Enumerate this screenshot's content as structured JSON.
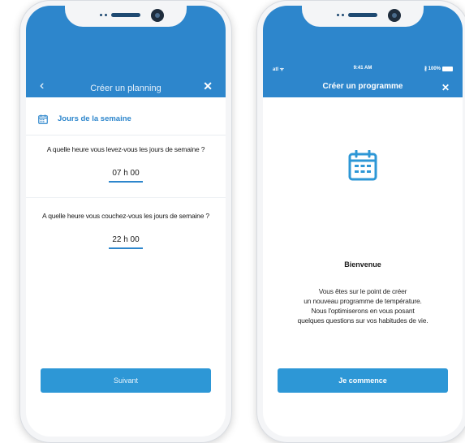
{
  "left_screen": {
    "title": "Créer un planning",
    "back_glyph": "‹",
    "close_glyph": "✕",
    "section_label": "Jours de la semaine",
    "section_icon": "calendar-icon",
    "question_wake": "A quelle heure vous levez-vous les jours de semaine ?",
    "wake_time": "07 h 00",
    "question_sleep": "A quelle heure vous couchez-vous les  jours de semaine ?",
    "sleep_time": "22 h 00",
    "next_button": "Suivant"
  },
  "right_screen": {
    "status_signal": "atl ᯤ",
    "status_time": "9:41 AM",
    "status_battery": "∦ 100%",
    "title": "Créer un programme",
    "close_glyph": "✕",
    "welcome_icon": "calendar-icon",
    "welcome_title": "Bienvenue",
    "welcome_lines": [
      "Vous êtes sur le point de créer",
      "un nouveau programme de température.",
      "Nous l'optimiserons en vous posant",
      "quelques questions sur vos habitudes de vie."
    ],
    "start_button": "Je commence"
  },
  "colors": {
    "header_blue": "#2d86cc",
    "button_blue": "#2d97d6"
  }
}
